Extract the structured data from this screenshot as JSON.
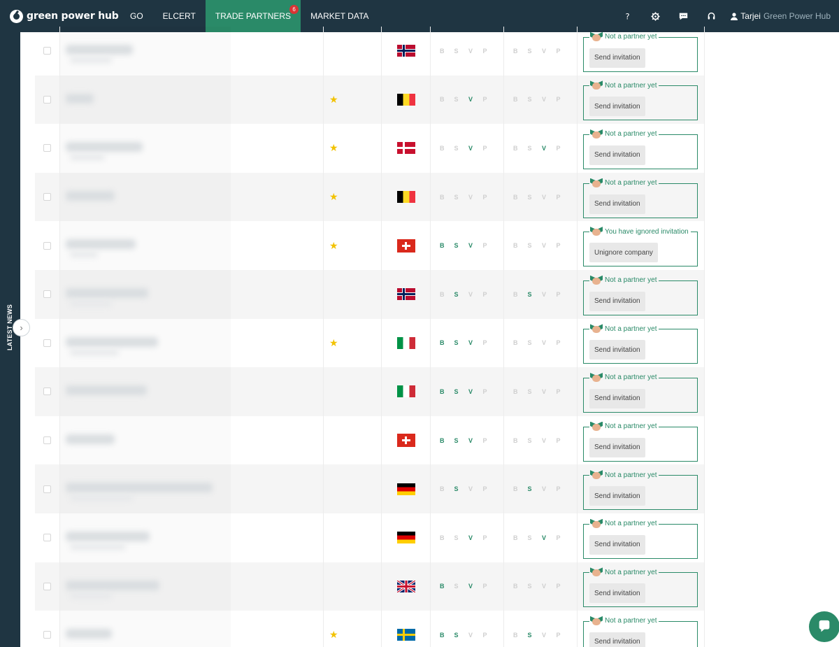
{
  "brand": {
    "name": "green power hub",
    "logo_icon": "aperture-logo-icon"
  },
  "nav": {
    "items": [
      {
        "label": "GO",
        "active": false
      },
      {
        "label": "ELCERT",
        "active": false
      },
      {
        "label": "TRADE PARTNERS",
        "active": true,
        "badge": "6"
      },
      {
        "label": "MARKET DATA",
        "active": false
      }
    ],
    "icons": [
      "help-icon",
      "settings-gear-icon",
      "chat-message-icon",
      "headset-support-icon"
    ],
    "user": {
      "name": "Tarjei",
      "org": "Green Power Hub",
      "icon": "user-icon"
    }
  },
  "side_panel": {
    "label": "LATEST NEWS",
    "toggle_icon": "chevron-right-icon"
  },
  "bsvp_letters": [
    "B",
    "S",
    "V",
    "P"
  ],
  "colors": {
    "brand_dark": "#1f3542",
    "accent_green": "#2a8a68",
    "star": "#f2c200",
    "badge": "#d93434"
  },
  "rows": [
    {
      "starred": false,
      "country_flag": "norway-flag",
      "bsvp1": [
        false,
        false,
        false,
        false
      ],
      "bsvp2": [
        false,
        false,
        false,
        false
      ],
      "status": "Not a partner yet",
      "action": "Send invitation"
    },
    {
      "starred": true,
      "country_flag": "belgium-flag",
      "bsvp1": [
        false,
        false,
        true,
        false
      ],
      "bsvp2": [
        false,
        false,
        false,
        false
      ],
      "status": "Not a partner yet",
      "action": "Send invitation"
    },
    {
      "starred": true,
      "country_flag": "denmark-flag",
      "bsvp1": [
        false,
        false,
        true,
        false
      ],
      "bsvp2": [
        false,
        false,
        true,
        false
      ],
      "status": "Not a partner yet",
      "action": "Send invitation"
    },
    {
      "starred": true,
      "country_flag": "belgium-flag",
      "bsvp1": [
        false,
        false,
        false,
        false
      ],
      "bsvp2": [
        false,
        false,
        false,
        false
      ],
      "status": "Not a partner yet",
      "action": "Send invitation"
    },
    {
      "starred": true,
      "country_flag": "switzerland-flag",
      "bsvp1": [
        true,
        true,
        true,
        false
      ],
      "bsvp2": [
        false,
        false,
        false,
        false
      ],
      "status": "You have ignored invitation",
      "action": "Unignore company"
    },
    {
      "starred": false,
      "country_flag": "norway-flag",
      "bsvp1": [
        false,
        true,
        false,
        false
      ],
      "bsvp2": [
        false,
        true,
        false,
        false
      ],
      "status": "Not a partner yet",
      "action": "Send invitation"
    },
    {
      "starred": true,
      "country_flag": "italy-flag",
      "bsvp1": [
        true,
        true,
        true,
        false
      ],
      "bsvp2": [
        false,
        false,
        false,
        false
      ],
      "status": "Not a partner yet",
      "action": "Send invitation"
    },
    {
      "starred": false,
      "country_flag": "italy-flag",
      "bsvp1": [
        true,
        true,
        true,
        false
      ],
      "bsvp2": [
        false,
        false,
        false,
        false
      ],
      "status": "Not a partner yet",
      "action": "Send invitation"
    },
    {
      "starred": false,
      "country_flag": "switzerland-flag",
      "bsvp1": [
        true,
        true,
        true,
        false
      ],
      "bsvp2": [
        false,
        false,
        false,
        false
      ],
      "status": "Not a partner yet",
      "action": "Send invitation"
    },
    {
      "starred": false,
      "country_flag": "germany-flag",
      "bsvp1": [
        false,
        true,
        false,
        false
      ],
      "bsvp2": [
        false,
        true,
        false,
        false
      ],
      "status": "Not a partner yet",
      "action": "Send invitation"
    },
    {
      "starred": false,
      "country_flag": "germany-flag",
      "bsvp1": [
        false,
        false,
        true,
        false
      ],
      "bsvp2": [
        false,
        false,
        true,
        false
      ],
      "status": "Not a partner yet",
      "action": "Send invitation"
    },
    {
      "starred": false,
      "country_flag": "united-kingdom-flag",
      "bsvp1": [
        true,
        false,
        true,
        false
      ],
      "bsvp2": [
        false,
        false,
        false,
        false
      ],
      "status": "Not a partner yet",
      "action": "Send invitation"
    },
    {
      "starred": true,
      "country_flag": "sweden-flag",
      "bsvp1": [
        true,
        true,
        false,
        false
      ],
      "bsvp2": [
        false,
        true,
        false,
        false
      ],
      "status": "Not a partner yet",
      "action": "Send invitation"
    }
  ],
  "chat_widget": {
    "icon": "chat-bubble-icon"
  }
}
